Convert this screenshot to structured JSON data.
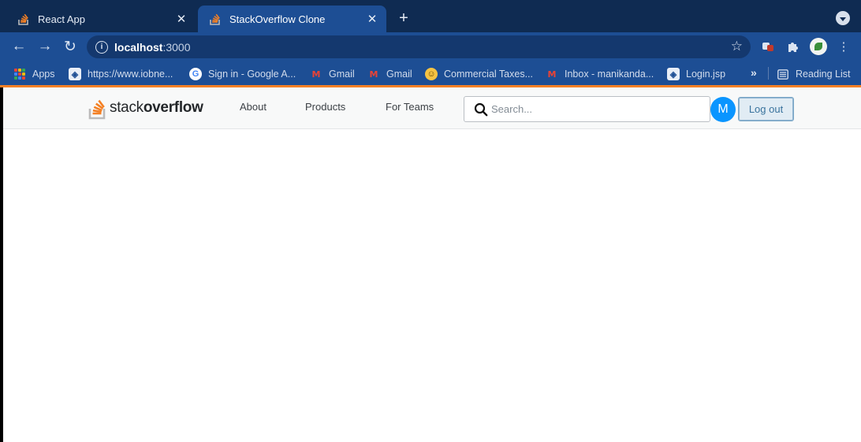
{
  "browser": {
    "tabs": [
      {
        "title": "React App",
        "active": false
      },
      {
        "title": "StackOverflow Clone",
        "active": true
      }
    ],
    "new_tab_symbol": "+",
    "close_symbol": "✕",
    "address": {
      "host": "localhost",
      "port": ":3000"
    },
    "bookmarks": [
      {
        "label": "Apps",
        "icon": "apps-grid-icon"
      },
      {
        "label": "https://www.iobne...",
        "icon": "globe-icon"
      },
      {
        "label": "Sign in - Google A...",
        "icon": "google-icon"
      },
      {
        "label": "Gmail",
        "icon": "gmail-icon"
      },
      {
        "label": "Gmail",
        "icon": "gmail-icon"
      },
      {
        "label": "Commercial Taxes...",
        "icon": "emoji-icon"
      },
      {
        "label": "Inbox - manikanda...",
        "icon": "gmail-icon"
      },
      {
        "label": "Login.jsp",
        "icon": "globe-icon"
      }
    ],
    "more_bookmarks": "»",
    "reading_list": "Reading List"
  },
  "navbar": {
    "logo": {
      "light": "stack",
      "bold": "overflow"
    },
    "links": [
      "About",
      "Products",
      "For Teams"
    ],
    "search_placeholder": "Search...",
    "avatar_letter": "M",
    "logout_label": "Log out"
  },
  "colors": {
    "brand_orange": "#f48024",
    "avatar_blue": "#0a95ff",
    "logout_bg": "#e1ecf4",
    "browser_frame": "#1d4e94"
  }
}
